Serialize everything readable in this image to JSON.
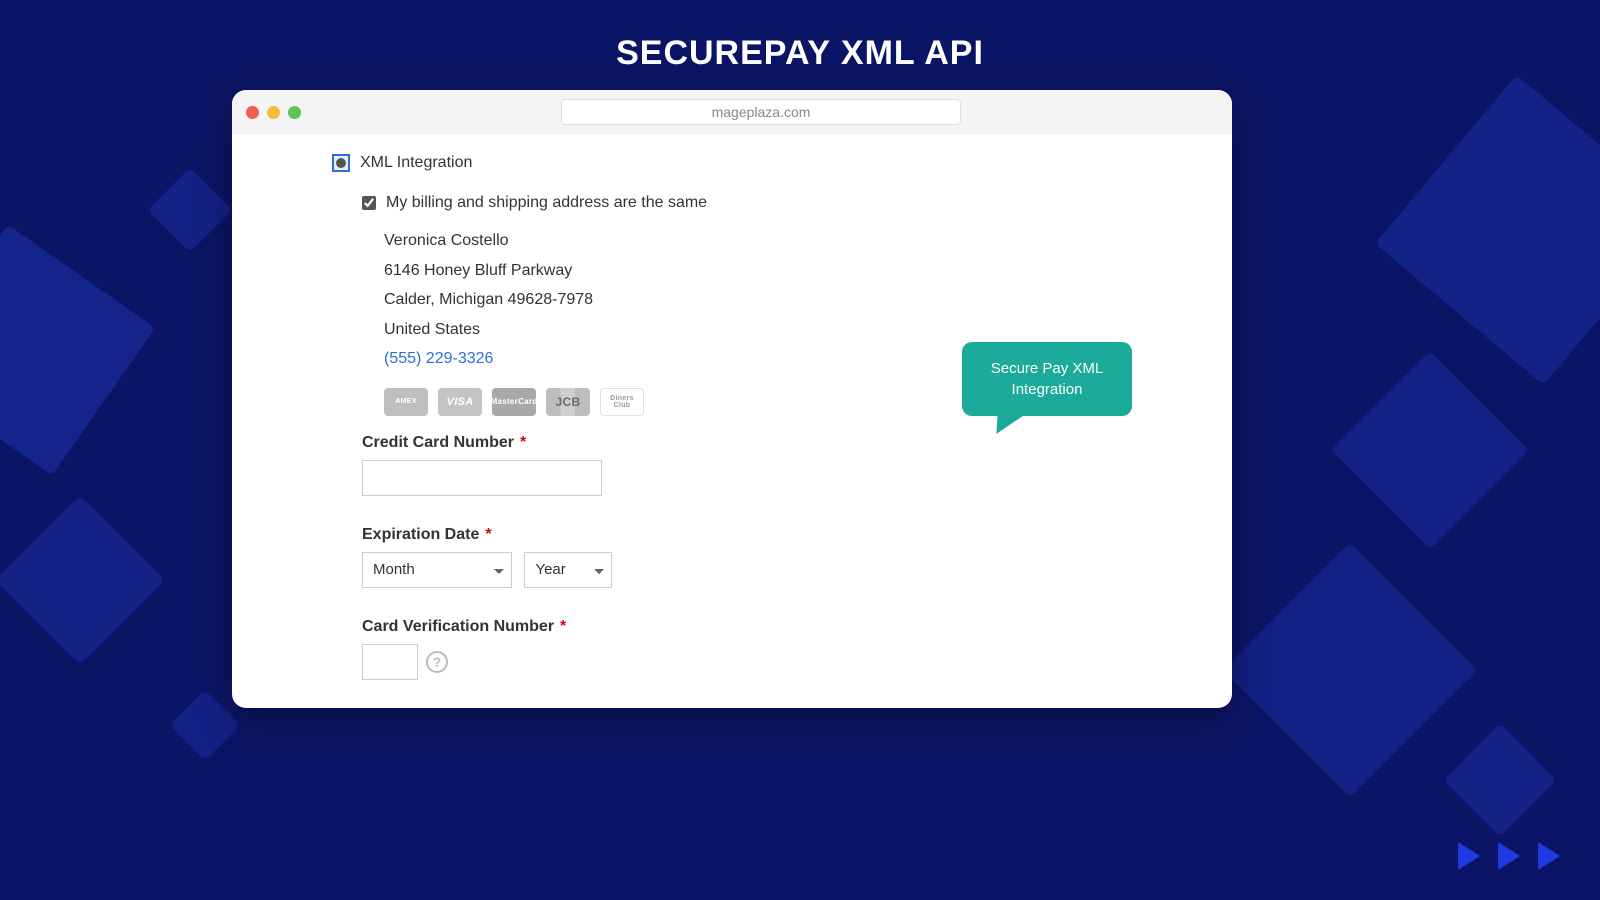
{
  "title": "SECUREPAY XML API",
  "url": "mageplaza.com",
  "payment_option_label": "XML Integration",
  "same_address_label": "My billing and shipping address are the same",
  "same_address_checked": true,
  "address": {
    "name": "Veronica Costello",
    "street": "6146 Honey Bluff Parkway",
    "city_line": "Calder, Michigan 49628-7978",
    "country": "United States",
    "phone": "(555) 229-3326"
  },
  "card_brands": [
    "AMEX",
    "VISA",
    "MasterCard",
    "JCB",
    "Diners Club"
  ],
  "fields": {
    "cc_label": "Credit Card Number",
    "exp_label": "Expiration Date",
    "cvv_label": "Card Verification Number",
    "month_placeholder": "Month",
    "year_placeholder": "Year"
  },
  "required_marker": "*",
  "callout_text": "Secure Pay XML Integration"
}
